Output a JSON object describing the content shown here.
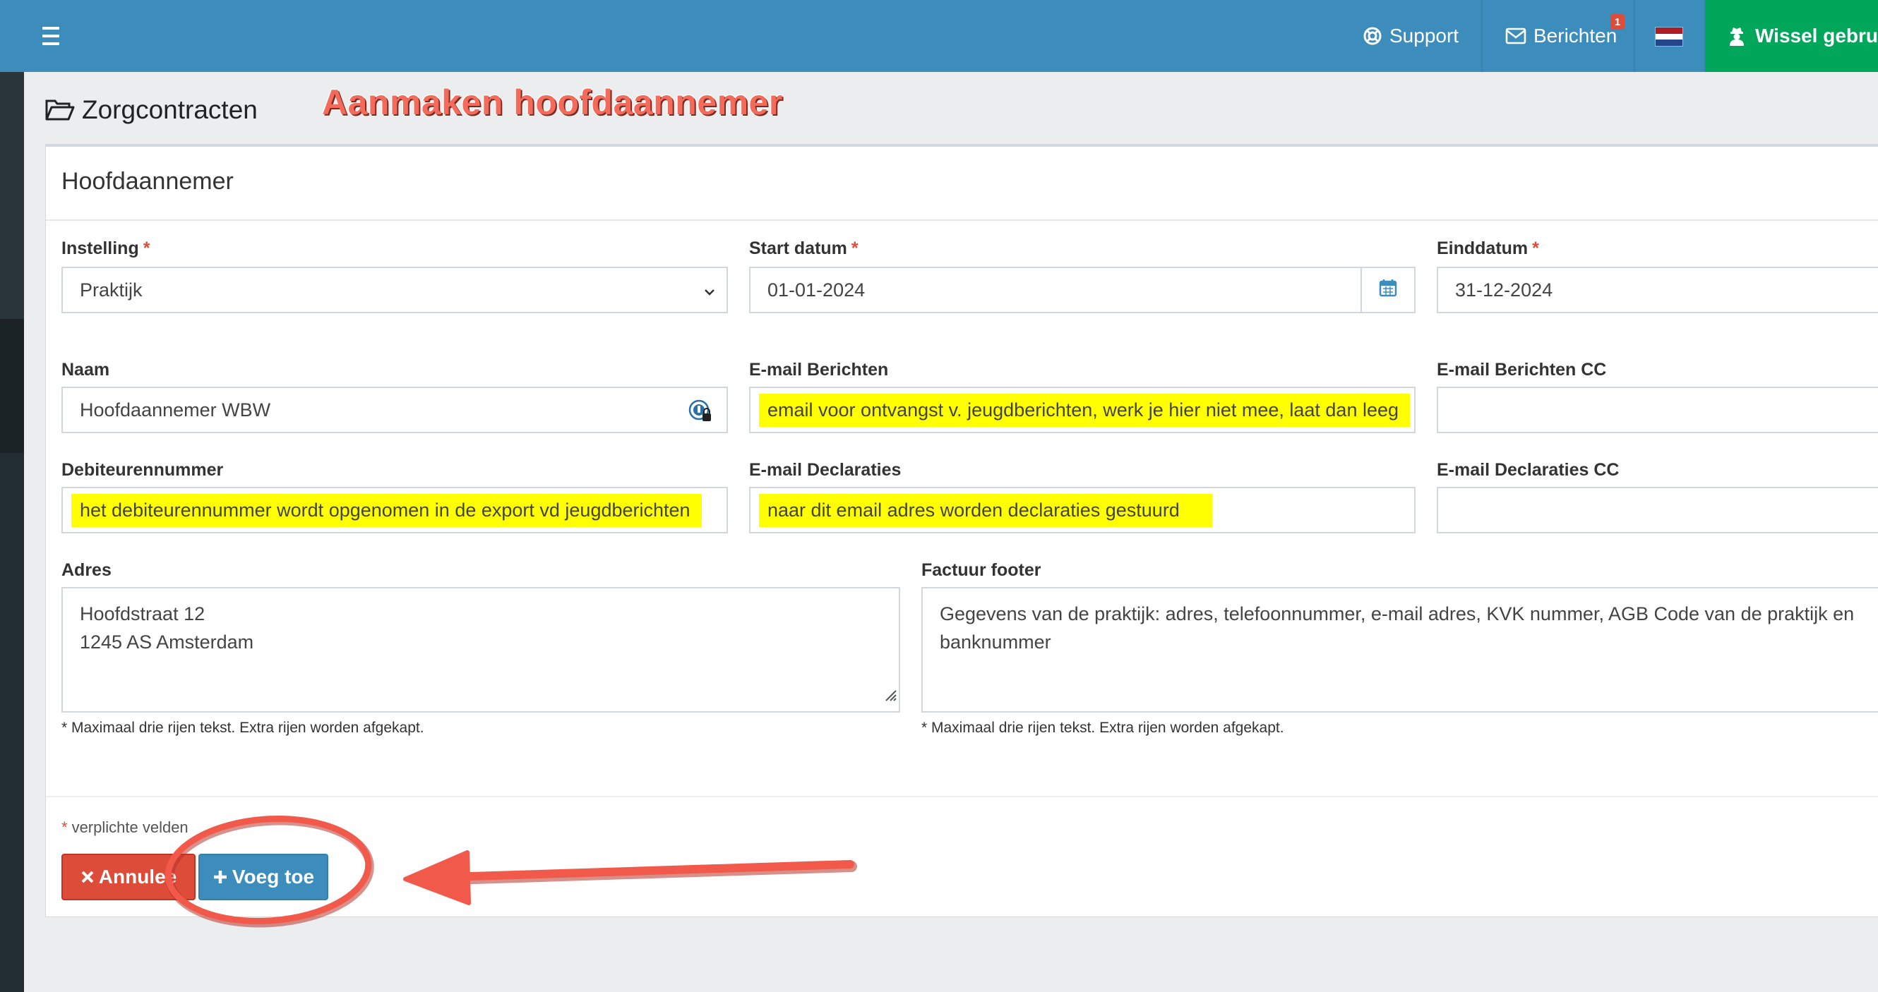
{
  "navbar": {
    "support_label": "Support",
    "messages_label": "Berichten",
    "messages_badge": "1",
    "switch_user_label": "Wissel gebruik",
    "language_icon": "flag-nl-icon",
    "colors": {
      "primary": "#3c8dbc",
      "success": "#00a65a",
      "danger": "#dd4b39"
    }
  },
  "page": {
    "title": "Zorgcontracten",
    "annotation_title": "Aanmaken hoofdaannemer"
  },
  "form": {
    "box_title": "Hoofdaannemer",
    "required_mark": "*",
    "instelling": {
      "label": "Instelling",
      "value": "Praktijk"
    },
    "start_datum": {
      "label": "Start datum",
      "value": "01-01-2024"
    },
    "einddatum": {
      "label": "Einddatum",
      "value": "31-12-2024"
    },
    "naam": {
      "label": "Naam",
      "value": "Hoofdaannemer WBW"
    },
    "email_berichten": {
      "label": "E-mail Berichten",
      "value": "email voor ontvangst v. jeugdberichten, werk je hier niet mee, laat dan leeg"
    },
    "email_berichten_cc": {
      "label": "E-mail Berichten CC",
      "value": ""
    },
    "debiteurennummer": {
      "label": "Debiteurennummer",
      "value": "het debiteurennummer wordt opgenomen in de export vd jeugdberichten"
    },
    "email_declaraties": {
      "label": "E-mail Declaraties",
      "value": "naar dit email adres worden declaraties gestuurd"
    },
    "email_declaraties_cc": {
      "label": "E-mail Declaraties CC",
      "value": ""
    },
    "adres": {
      "label": "Adres",
      "line1": "Hoofdstraat 12",
      "line2": "1245 AS Amsterdam"
    },
    "factuur_footer": {
      "label": "Factuur footer",
      "line1": "Gegevens van de praktijk: adres, telefoonnummer, e-mail adres, KVK nummer, AGB Code van de praktijk en",
      "line2": "banknummer"
    },
    "help_text": "* Maximaal drie rijen tekst. Extra rijen worden afgekapt.",
    "required_note": "verplichte velden",
    "cancel_label": "Annulee",
    "add_label": "Voeg toe"
  }
}
